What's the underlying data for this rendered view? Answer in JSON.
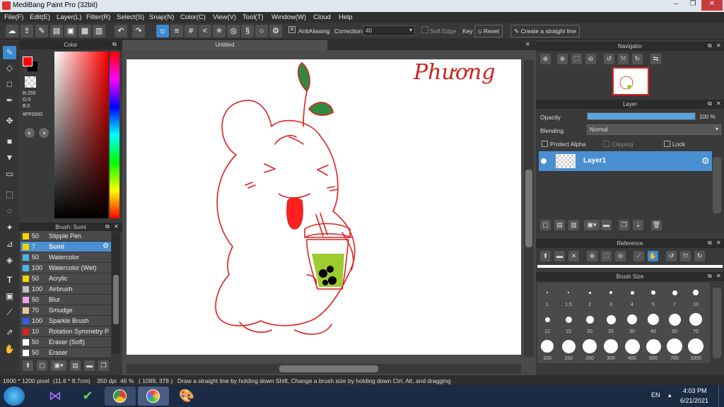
{
  "window": {
    "title": "MediBang Paint Pro (32bit)",
    "minimize": "–",
    "restore": "❐",
    "close": "✕"
  },
  "menu": [
    "File(F)",
    "Edit(E)",
    "Layer(L)",
    "Filter(R)",
    "Select(S)",
    "Snap(N)",
    "Color(C)",
    "View(V)",
    "Tool(T)",
    "Window(W)",
    "Cloud",
    "Help"
  ],
  "toolbar": {
    "antialiasing": "AntiAliasing",
    "correction_label": "Correction",
    "correction_value": "40",
    "soft_edge": "Soft Edge",
    "key": "Key",
    "reset": "Reset",
    "straight_line": "Create a straight line"
  },
  "color": {
    "title": "Color",
    "r": "R:255",
    "g": "G:0",
    "b": "B:0",
    "hex": "#FF0000",
    "primary": "#ff0000",
    "secondary": "#000000"
  },
  "brush": {
    "title": "Brush: Sumi",
    "items": [
      {
        "size": "50",
        "name": "Stipple Pen",
        "color": "#f2d600"
      },
      {
        "size": "7",
        "name": "Sumi",
        "color": "#f2d600"
      },
      {
        "size": "50",
        "name": "Watercolor",
        "color": "#4db5e8"
      },
      {
        "size": "100",
        "name": "Watercolor (Wet)",
        "color": "#4db5e8"
      },
      {
        "size": "50",
        "name": "Acrylic",
        "color": "#f2d600"
      },
      {
        "size": "100",
        "name": "Airbrush",
        "color": "#c0c0c0"
      },
      {
        "size": "50",
        "name": "Blur",
        "color": "#f0a0f0"
      },
      {
        "size": "70",
        "name": "Smudge",
        "color": "#e8c8a0"
      },
      {
        "size": "100",
        "name": "Sparkle Brush",
        "color": "#3060f0"
      },
      {
        "size": "10",
        "name": "Rotation Symmetry P",
        "color": "#e02020"
      },
      {
        "size": "50",
        "name": "Eraser (Soft)",
        "color": "#ffffff"
      },
      {
        "size": "50",
        "name": "Eraser",
        "color": "#ffffff"
      }
    ]
  },
  "canvas": {
    "tab": "Untitled",
    "signature": "Phương"
  },
  "navigator": {
    "title": "Navigator"
  },
  "layer": {
    "title": "Layer",
    "opacity_label": "Opacity",
    "opacity_value": "100 %",
    "opacity_fraction": 1.0,
    "blending_label": "Blending",
    "blending_value": "Normal",
    "protect_alpha": "Protect Alpha",
    "clipping": "Clipping",
    "lock": "Lock",
    "layer_name": "Layer1"
  },
  "reference": {
    "title": "Reference"
  },
  "brush_size": {
    "title": "Brush Size",
    "sizes": [
      "1",
      "1.5",
      "2",
      "3",
      "4",
      "5",
      "7",
      "10",
      "12",
      "15",
      "20",
      "25",
      "30",
      "40",
      "50",
      "70",
      "100",
      "150",
      "200",
      "300",
      "400",
      "500",
      "700",
      "1000"
    ]
  },
  "status": {
    "dimensions": "1600 * 1200 pixel",
    "cm": "(11.6 * 8.7cm)",
    "dpi": "350 dpi",
    "zoom": "46 %",
    "coords": "( 1089, 378 )",
    "hint": "Draw a straight line by holding down Shift, Change a brush size by holding down Ctrl, Alt, and dragging"
  },
  "taskbar": {
    "lang": "EN",
    "time": "4:03 PM",
    "date": "6/21/2021"
  }
}
